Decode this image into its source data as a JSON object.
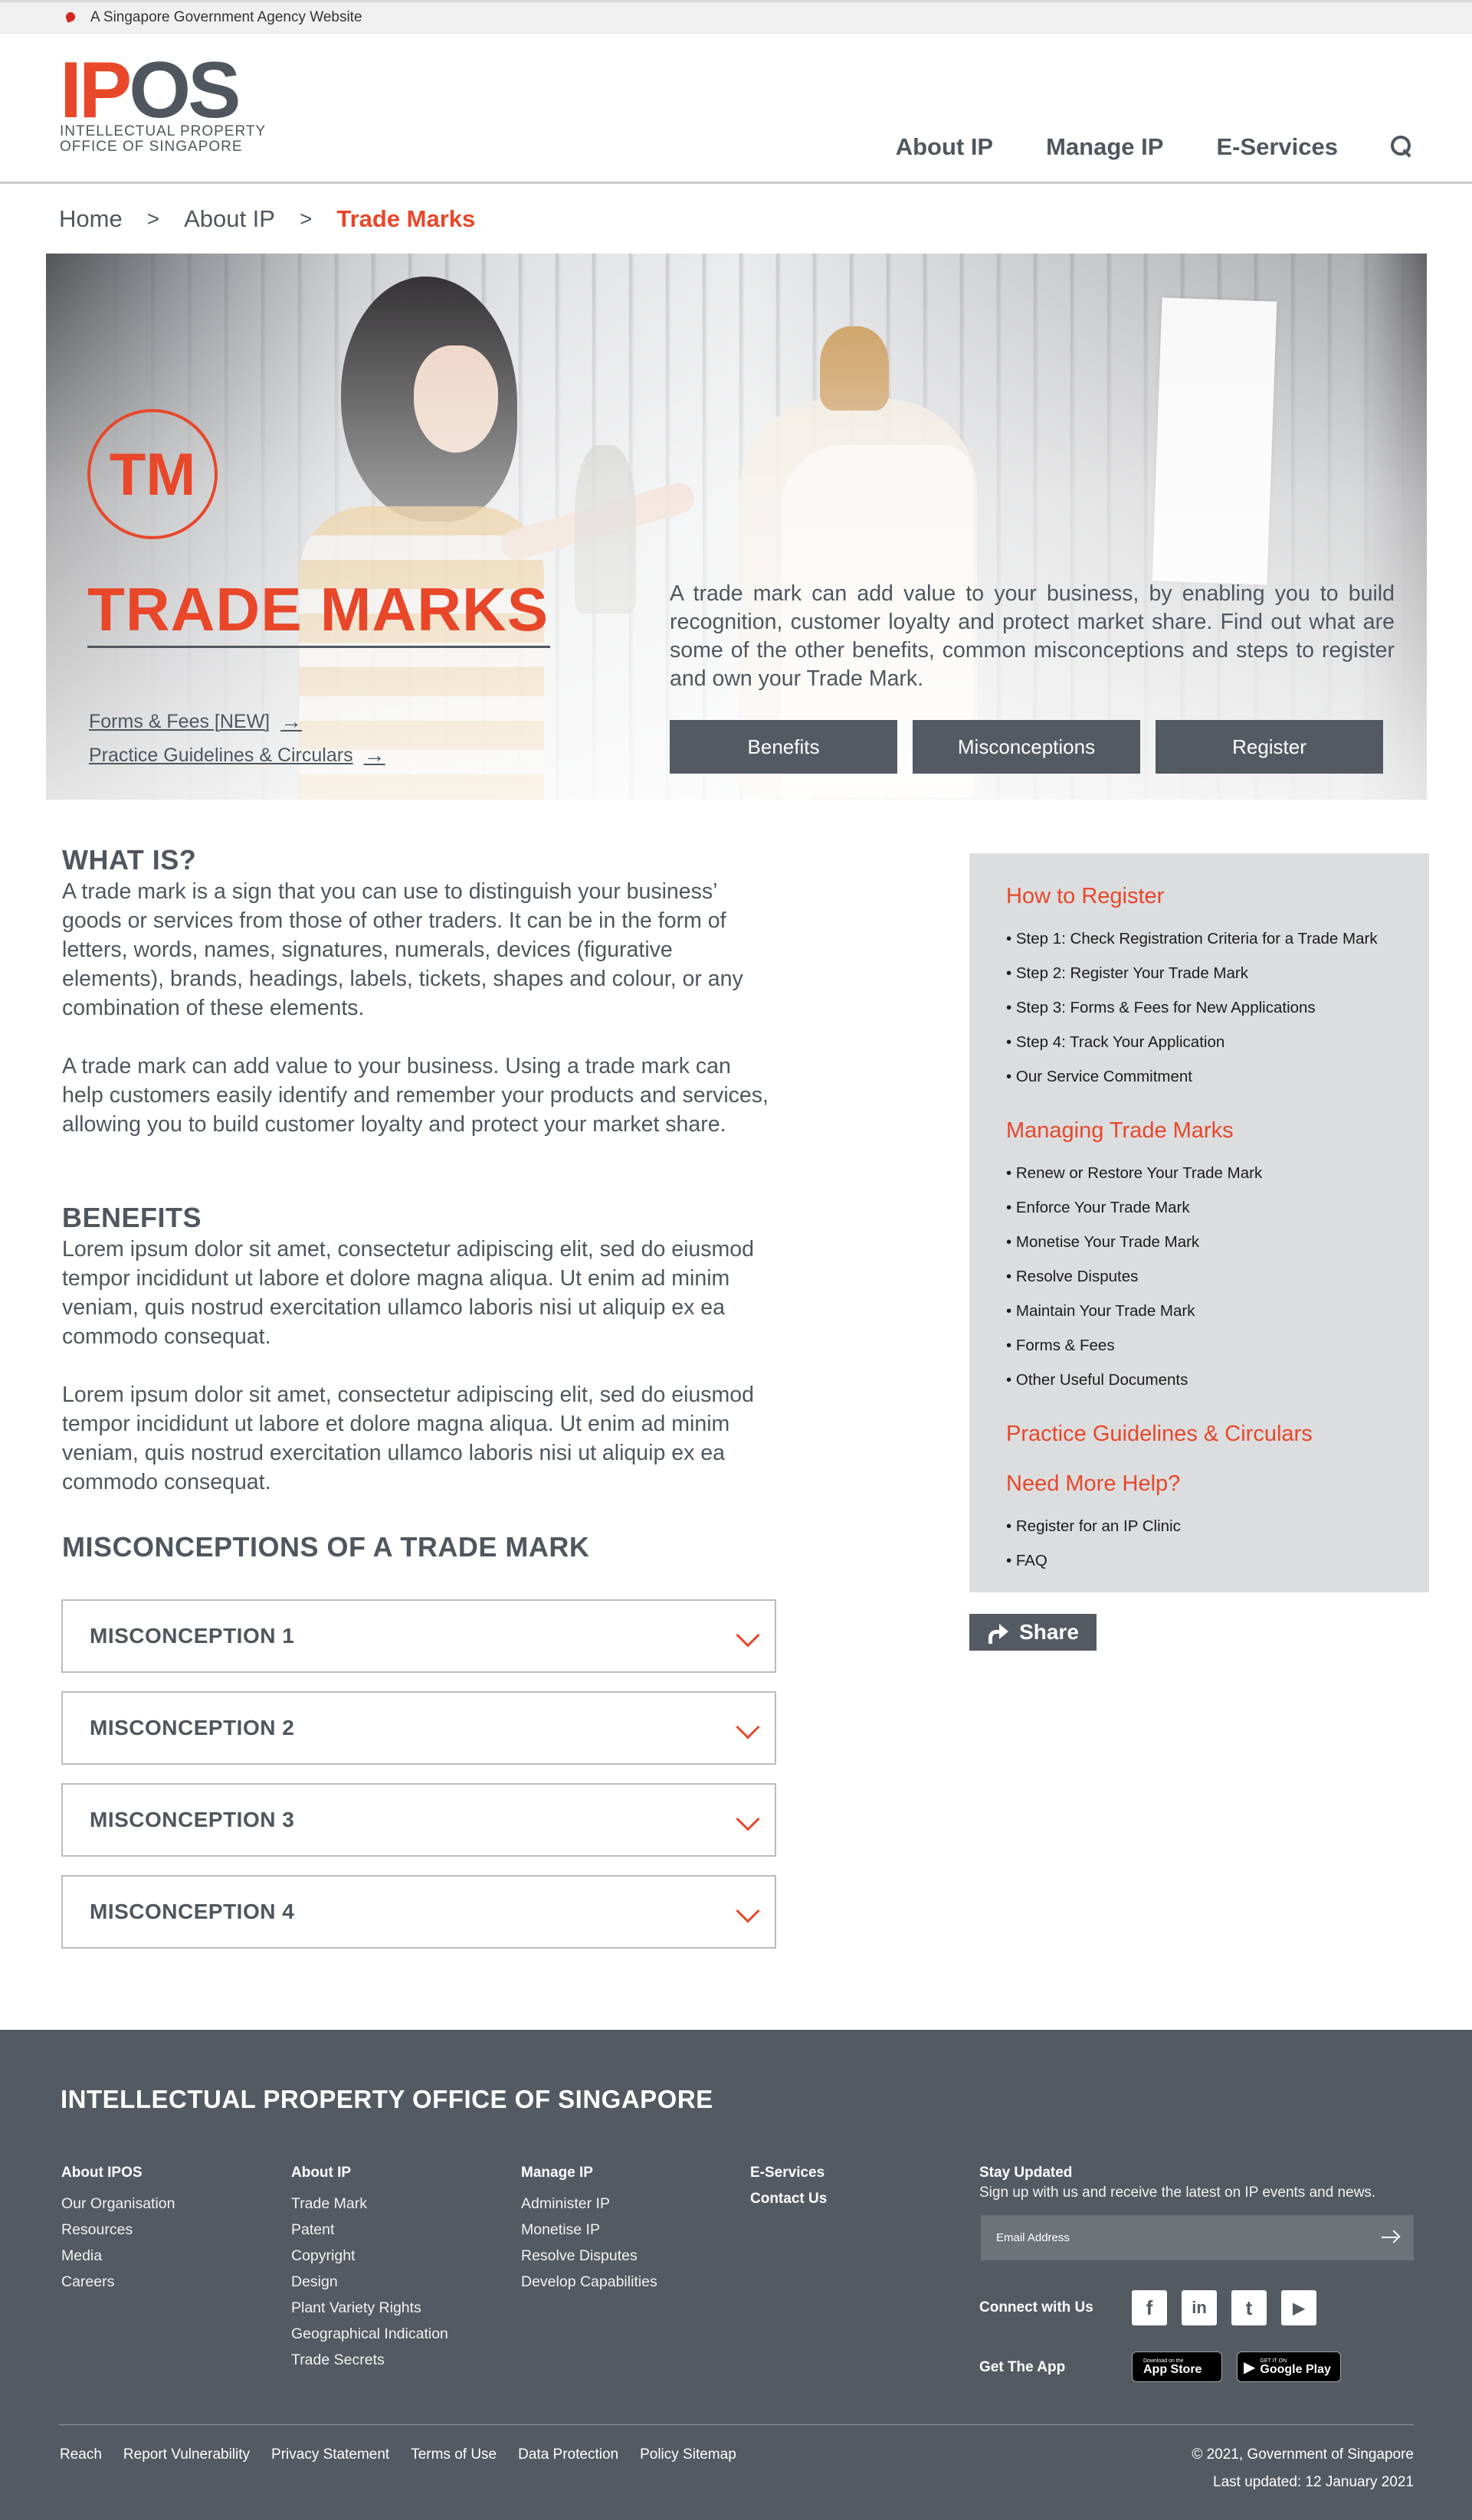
{
  "gov_bar": {
    "text": "A Singapore Government Agency Website"
  },
  "header": {
    "logo_ip": "IP",
    "logo_os": "OS",
    "logo_line1": "INTELLECTUAL PROPERTY",
    "logo_line2": "OFFICE OF SINGAPORE",
    "nav": [
      "About IP",
      "Manage IP",
      "E-Services"
    ]
  },
  "breadcrumb": {
    "home": "Home",
    "parent": "About IP",
    "current": "Trade Marks"
  },
  "hero": {
    "badge": "TM",
    "title": "TRADE MARKS",
    "links": [
      "Forms & Fees [NEW]",
      "Practice Guidelines & Circulars"
    ],
    "arrow": "→",
    "description": "A trade mark can add value to your business, by enabling you to build recognition, customer loyalty and protect market share. Find out what are some of the other benefits, common misconceptions and steps to register and own your Trade Mark.",
    "buttons": [
      "Benefits",
      "Misconceptions",
      "Register"
    ]
  },
  "main": {
    "what_is": {
      "heading": "WHAT IS?",
      "p1": "A trade mark is a sign that you can use to distinguish your business’ goods or services from those of other traders. It can be in the form of letters, words, names, signatures, numerals, devices (figurative elements), brands, headings, labels, tickets, shapes and colour, or any combination of these elements.",
      "p2": "A trade mark can add value to your business. Using a trade mark can help customers easily identify and remember your products and services, allowing you to build customer loyalty and protect your market share."
    },
    "benefits": {
      "heading": "BENEFITS",
      "p1": "Lorem ipsum dolor sit amet, consectetur adipiscing elit, sed do eiusmod tempor incididunt ut labore et dolore magna aliqua. Ut enim ad minim veniam, quis nostrud exercitation ullamco laboris nisi ut aliquip ex ea commodo consequat.",
      "p2": "Lorem ipsum dolor sit amet, consectetur adipiscing elit, sed do eiusmod tempor incididunt ut labore et dolore magna aliqua. Ut enim ad minim veniam, quis nostrud exercitation ullamco laboris nisi ut aliquip ex ea commodo consequat."
    },
    "misconceptions": {
      "heading": "MISCONCEPTIONS OF A TRADE MARK",
      "items": [
        "MISCONCEPTION 1",
        "MISCONCEPTION 2",
        "MISCONCEPTION 3",
        "MISCONCEPTION 4"
      ]
    }
  },
  "sidebar": {
    "how_to_register": {
      "heading": "How to Register",
      "items": [
        "• Step 1: Check Registration Criteria for a Trade Mark",
        "• Step 2: Register Your Trade Mark",
        "• Step 3: Forms & Fees for New Applications",
        "• Step 4: Track Your Application",
        "• Our Service Commitment"
      ]
    },
    "managing": {
      "heading": "Managing Trade Marks",
      "items": [
        "• Renew or Restore Your Trade Mark",
        "• Enforce Your Trade Mark",
        "• Monetise Your Trade Mark",
        "• Resolve Disputes",
        "• Maintain Your Trade Mark",
        "• Forms & Fees",
        "• Other Useful Documents"
      ]
    },
    "practice": {
      "heading": "Practice Guidelines & Circulars"
    },
    "help": {
      "heading": "Need More Help?",
      "items": [
        "• Register for an IP Clinic",
        "• FAQ"
      ]
    },
    "share_label": "Share"
  },
  "footer": {
    "title": "INTELLECTUAL PROPERTY OFFICE OF SINGAPORE",
    "columns": [
      {
        "heading": "About IPOS",
        "links": [
          "Our Organisation",
          "Resources",
          "Media",
          "Careers"
        ]
      },
      {
        "heading": "About IP",
        "links": [
          "Trade Mark",
          "Patent",
          "Copyright",
          "Design",
          "Plant Variety Rights",
          "Geographical Indication",
          "Trade Secrets"
        ]
      },
      {
        "heading": "Manage IP",
        "links": [
          "Administer IP",
          "Monetise IP",
          "Resolve Disputes",
          "Develop Capabilities"
        ]
      },
      {
        "heading": "E-Services",
        "links": []
      }
    ],
    "contact_us": "Contact Us",
    "stay_updated": {
      "heading": "Stay Updated",
      "sub": "Sign up with us and receive the latest on IP events and news.",
      "email_placeholder": "Email Address"
    },
    "connect_heading": "Connect with Us",
    "social": [
      "f",
      "in",
      "t",
      "▶"
    ],
    "app_heading": "Get The App",
    "app_store": {
      "small": "Download on the",
      "big": "App Store"
    },
    "google_play": {
      "small": "GET IT ON",
      "big": "Google Play"
    },
    "bottom_links": [
      "Reach",
      "Report Vulnerability",
      "Privacy Statement",
      "Terms of Use",
      "Data Protection",
      "Policy Sitemap"
    ],
    "copyright": "© 2021, Government of Singapore",
    "last_updated": "Last updated: 12 January 2021"
  },
  "colors": {
    "accent": "#e8472a",
    "slate": "#535a62",
    "text": "#4f565e",
    "sidebar_bg": "#dcdddf"
  }
}
